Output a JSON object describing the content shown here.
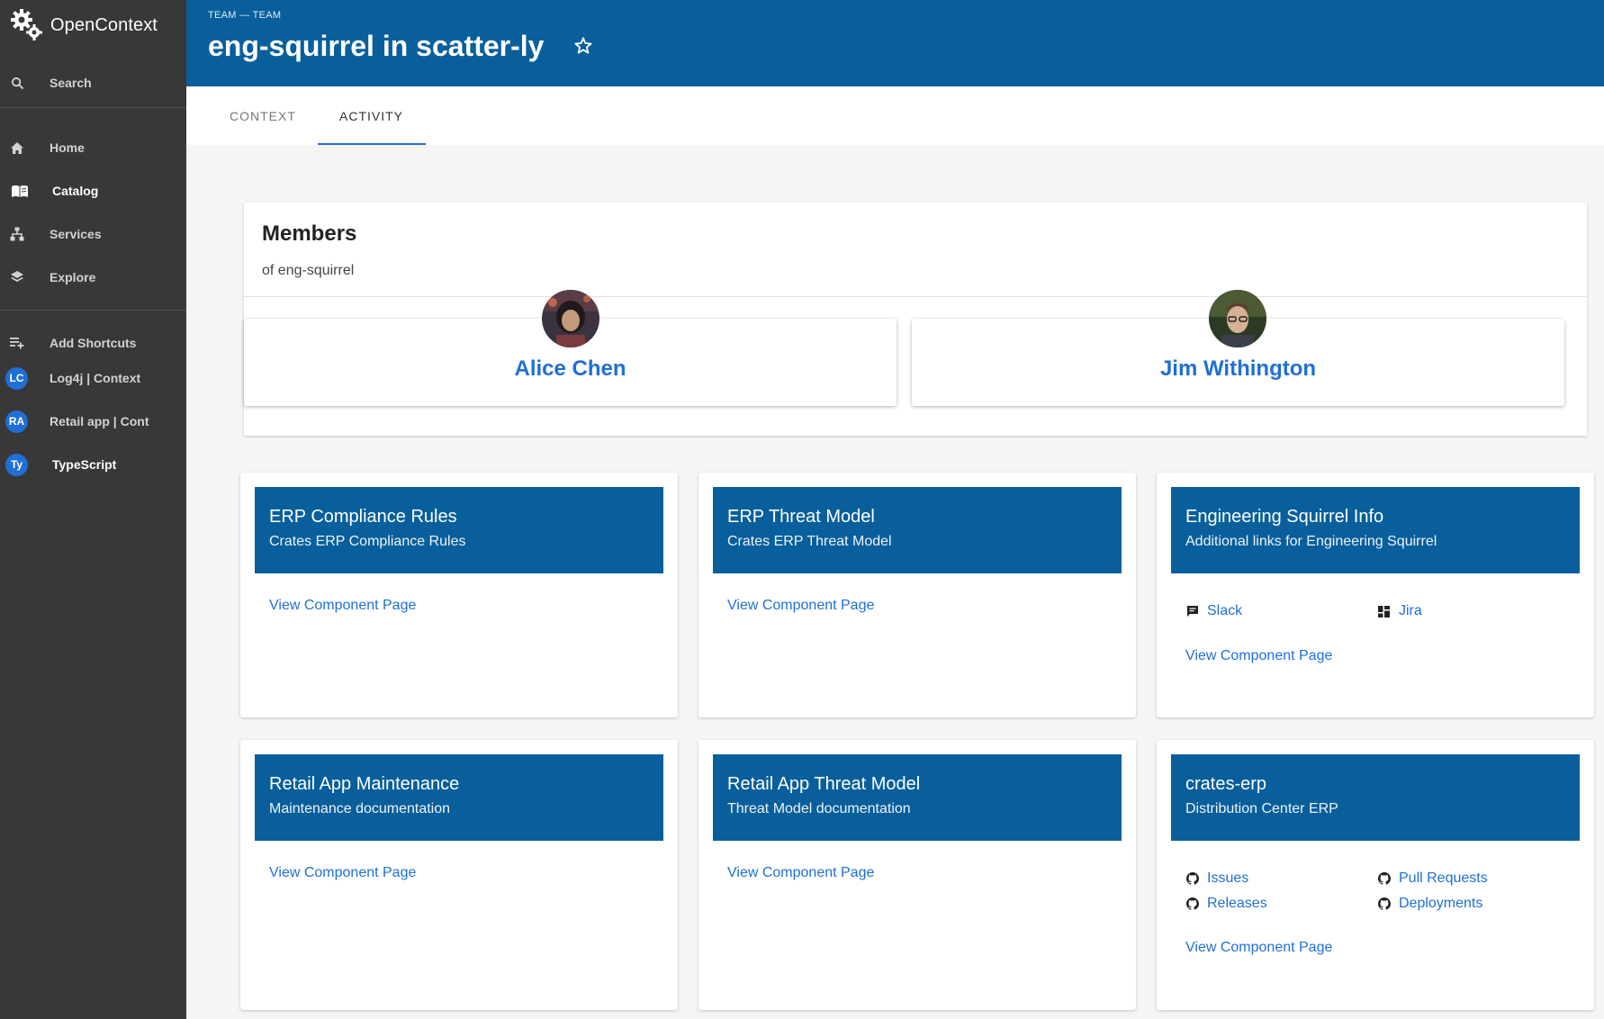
{
  "app": {
    "name": "OpenContext"
  },
  "sidebar": {
    "search_label": "Search",
    "items": [
      {
        "label": "Home",
        "icon": "home-icon"
      },
      {
        "label": "Catalog",
        "icon": "book-icon",
        "active": true
      },
      {
        "label": "Services",
        "icon": "sitemap-icon"
      },
      {
        "label": "Explore",
        "icon": "layers-icon"
      }
    ],
    "add_shortcuts_label": "Add Shortcuts",
    "shortcuts": [
      {
        "badge": "LC",
        "label": "Log4j | Context"
      },
      {
        "badge": "RA",
        "label": "Retail app | Context"
      },
      {
        "badge": "Ty",
        "label": "TypeScript"
      }
    ]
  },
  "header": {
    "breadcrumb": "TEAM — TEAM",
    "title": "eng-squirrel in scatter-ly"
  },
  "tabs": [
    {
      "label": "CONTEXT"
    },
    {
      "label": "ACTIVITY",
      "active": true
    }
  ],
  "members": {
    "title": "Members",
    "subtitle": "of eng-squirrel",
    "people": [
      {
        "name": "Alice Chen"
      },
      {
        "name": "Jim Withington"
      }
    ]
  },
  "cards": [
    {
      "title": "ERP Compliance Rules",
      "subtitle": "Crates ERP Compliance Rules",
      "link": "View Component Page"
    },
    {
      "title": "ERP Threat Model",
      "subtitle": "Crates ERP Threat Model",
      "link": "View Component Page"
    },
    {
      "title": "Engineering Squirrel Info",
      "subtitle": "Additional links for Engineering Squirrel",
      "links": [
        {
          "label": "Slack",
          "icon": "chat-icon"
        },
        {
          "label": "Jira",
          "icon": "dashboard-icon"
        }
      ],
      "link": "View Component Page"
    },
    {
      "title": "Retail App Maintenance",
      "subtitle": "Maintenance documentation",
      "link": "View Component Page"
    },
    {
      "title": "Retail App Threat Model",
      "subtitle": "Threat Model documentation",
      "link": "View Component Page"
    },
    {
      "title": "crates-erp",
      "subtitle": "Distribution Center ERP",
      "links": [
        {
          "label": "Issues",
          "icon": "github-icon"
        },
        {
          "label": "Pull Requests",
          "icon": "github-icon"
        },
        {
          "label": "Releases",
          "icon": "github-icon"
        },
        {
          "label": "Deployments",
          "icon": "github-icon"
        }
      ],
      "link": "View Component Page"
    }
  ],
  "colors": {
    "sidebar": "#383838",
    "brand": "#085f9c",
    "link": "#1f6fd6"
  }
}
